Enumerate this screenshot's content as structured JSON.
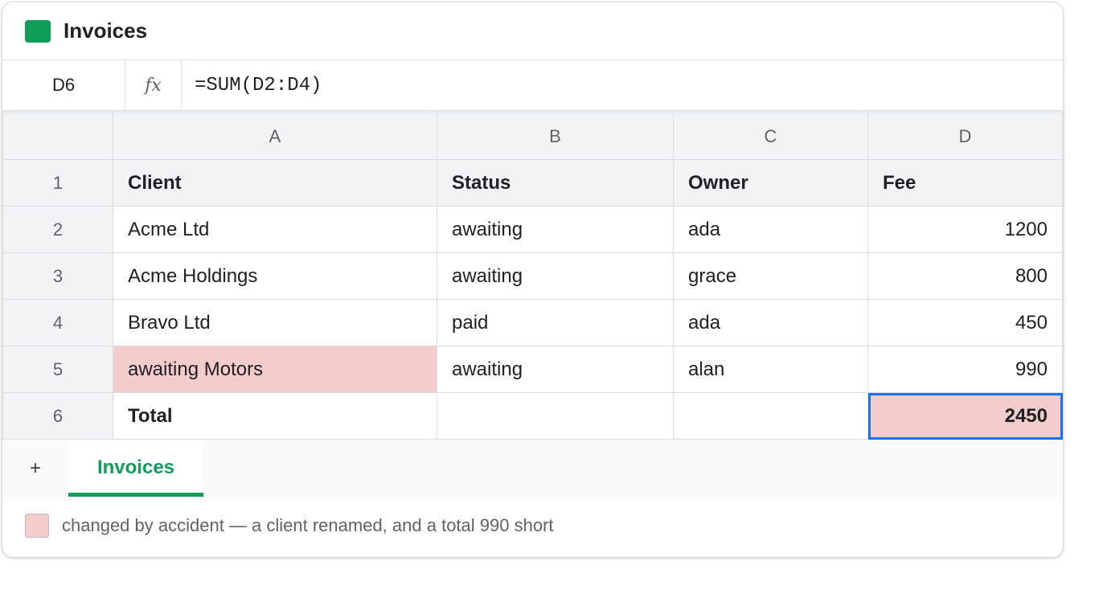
{
  "colors": {
    "accent": "#0f9d58",
    "flagged": "#f4cccc",
    "selection": "#1a73e8"
  },
  "app": {
    "title": "Invoices",
    "icon": "sheets-app-icon"
  },
  "formula_bar": {
    "cell_ref": "D6",
    "fx_label": "fx",
    "formula": "=SUM(D2:D4)"
  },
  "grid": {
    "columns": [
      "A",
      "B",
      "C",
      "D"
    ],
    "row_numbers": [
      "1",
      "2",
      "3",
      "4",
      "5",
      "6"
    ],
    "rows": [
      [
        "Client",
        "Status",
        "Owner",
        "Fee"
      ],
      [
        "Acme Ltd",
        "awaiting",
        "ada",
        "1200"
      ],
      [
        "Acme Holdings",
        "awaiting",
        "grace",
        "800"
      ],
      [
        "Bravo Ltd",
        "paid",
        "ada",
        "450"
      ],
      [
        "awaiting Motors",
        "awaiting",
        "alan",
        "990"
      ],
      [
        "Total",
        "",
        "",
        "2450"
      ]
    ],
    "selected_cell": "D6",
    "flagged_cells": [
      "A5",
      "D6"
    ]
  },
  "sheets": {
    "add_label": "+",
    "tabs": [
      "Invoices"
    ],
    "active": "Invoices"
  },
  "legend": {
    "text": "changed by accident — a client renamed, and a total 990 short"
  }
}
